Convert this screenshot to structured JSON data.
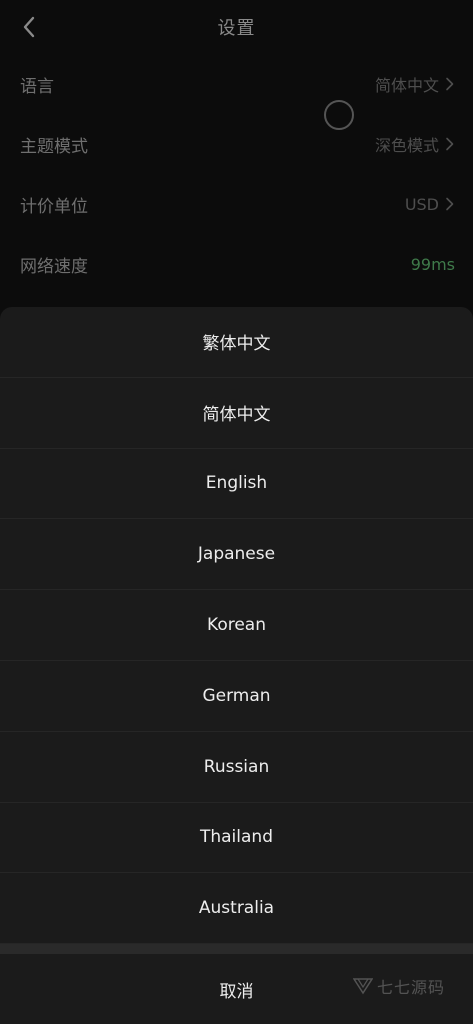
{
  "header": {
    "title": "设置",
    "back_icon": "chevron-left-icon"
  },
  "settings": [
    {
      "label": "语言",
      "value": "简体中文",
      "has_chevron": true
    },
    {
      "label": "主题模式",
      "value": "深色模式",
      "has_chevron": true
    },
    {
      "label": "计价单位",
      "value": "USD",
      "has_chevron": true
    },
    {
      "label": "网络速度",
      "value": "99ms",
      "has_chevron": false,
      "value_color": "#3f7a4a"
    }
  ],
  "language_sheet": {
    "options": [
      "繁体中文",
      "简体中文",
      "English",
      "Japanese",
      "Korean",
      "German",
      "Russian",
      "Thailand",
      "Australia"
    ],
    "cancel_label": "取消"
  },
  "watermark": {
    "text": "七七源码"
  },
  "colors": {
    "background": "#0c0c0c",
    "sheet": "#1b1b1b",
    "accent_green": "#3f7a4a"
  }
}
